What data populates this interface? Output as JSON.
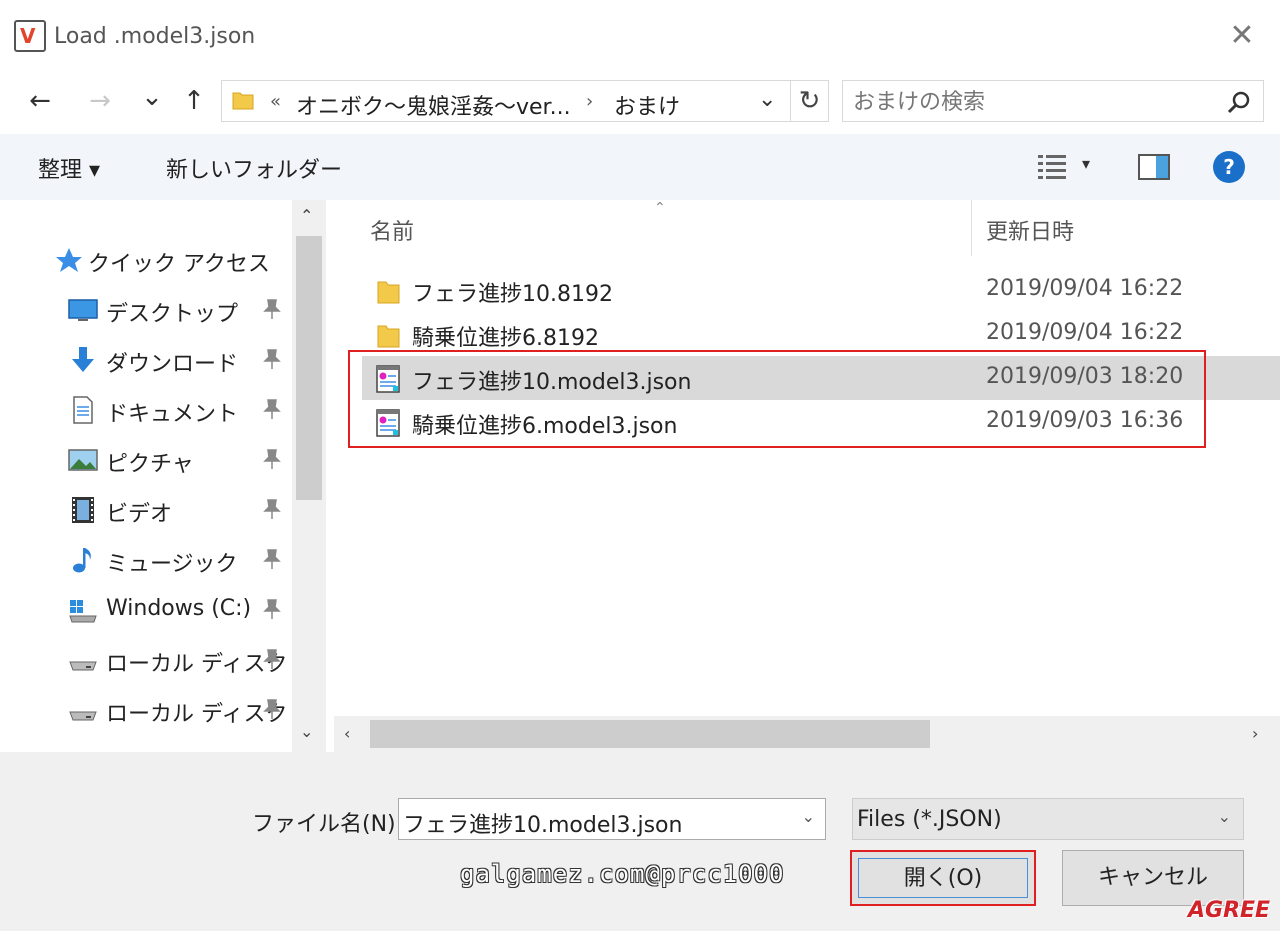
{
  "window": {
    "title": "Load .model3.json",
    "close_glyph": "✕"
  },
  "nav": {
    "back_glyph": "←",
    "forward_glyph": "→",
    "recent_glyph": "⌄",
    "up_glyph": "↑",
    "address": {
      "overflow": "«",
      "segments": [
        "オニボク～鬼娘淫姦～ver...",
        "おまけ"
      ],
      "separator": "›",
      "dropdown_glyph": "⌄",
      "refresh_glyph": "↻"
    },
    "search": {
      "placeholder": "おまけの検索"
    }
  },
  "toolbar": {
    "organize": "整理 ▾",
    "new_folder": "新しいフォルダー",
    "view_dropdown": "▾",
    "help_glyph": "?"
  },
  "sidebar": {
    "items": [
      {
        "label": "クイック アクセス",
        "icon": "star-icon"
      },
      {
        "label": "デスクトップ",
        "icon": "desktop-icon"
      },
      {
        "label": "ダウンロード",
        "icon": "download-icon"
      },
      {
        "label": "ドキュメント",
        "icon": "document-icon"
      },
      {
        "label": "ピクチャ",
        "icon": "pictures-icon"
      },
      {
        "label": "ビデオ",
        "icon": "video-icon"
      },
      {
        "label": "ミュージック",
        "icon": "music-icon"
      },
      {
        "label": "Windows (C:)",
        "icon": "windows-drive-icon"
      },
      {
        "label": "ローカル ディスク",
        "icon": "drive-icon"
      },
      {
        "label": "ローカル ディスク",
        "icon": "drive-icon"
      }
    ],
    "scroll_up": "⌃",
    "scroll_down": "⌄"
  },
  "filelist": {
    "columns": {
      "name": "名前",
      "modified": "更新日時"
    },
    "sort_glyph": "⌃",
    "files": [
      {
        "name": "フェラ進捗10.8192",
        "modified": "2019/09/04 16:22",
        "type": "folder"
      },
      {
        "name": "騎乗位進捗6.8192",
        "modified": "2019/09/04 16:22",
        "type": "folder"
      },
      {
        "name": "フェラ進捗10.model3.json",
        "modified": "2019/09/03 18:20",
        "type": "json",
        "selected": true
      },
      {
        "name": "騎乗位進捗6.model3.json",
        "modified": "2019/09/03 16:36",
        "type": "json"
      }
    ],
    "scroll_left": "‹",
    "scroll_right": "›"
  },
  "bottom": {
    "filename_label": "ファイル名(N):",
    "filename_value": "フェラ進捗10.model3.json",
    "filetype_value": "Files (*.JSON)",
    "dropdown_glyph": "⌄",
    "open_label": "開く(O)",
    "cancel_label": "キャンセル",
    "watermark": "galgamez.com@prcc1000",
    "logo": "AGREE"
  },
  "colors": {
    "accent": "#1a6fc9",
    "highlight": "#e02020",
    "toolbar_bg": "#f2f6fb",
    "selected_row": "#d9d9d9",
    "folder": "#f3c94a"
  }
}
